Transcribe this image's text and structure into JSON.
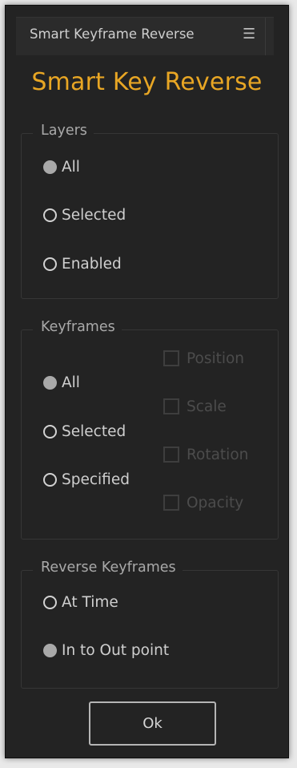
{
  "panel": {
    "tab_title": "Smart Keyframe Reverse",
    "menu_icon": "hamburger-menu-icon"
  },
  "title": "Smart Key Reverse",
  "layers": {
    "legend": "Layers",
    "options": [
      {
        "label": "All",
        "selected": true
      },
      {
        "label": "Selected",
        "selected": false
      },
      {
        "label": "Enabled",
        "selected": false
      }
    ]
  },
  "keyframes": {
    "legend": "Keyframes",
    "options": [
      {
        "label": "All",
        "selected": true
      },
      {
        "label": "Selected",
        "selected": false
      },
      {
        "label": "Specified",
        "selected": false
      }
    ],
    "properties": [
      {
        "label": "Position",
        "checked": false,
        "enabled": false
      },
      {
        "label": "Scale",
        "checked": false,
        "enabled": false
      },
      {
        "label": "Rotation",
        "checked": false,
        "enabled": false
      },
      {
        "label": "Opacity",
        "checked": false,
        "enabled": false
      }
    ]
  },
  "reverse": {
    "legend": "Reverse Keyframes",
    "options": [
      {
        "label": "At Time",
        "selected": false
      },
      {
        "label": "In to Out point",
        "selected": true
      }
    ]
  },
  "ok_label": "Ok",
  "colors": {
    "accent": "#e8a624",
    "panel_bg": "#232323",
    "text": "#cfcfcf",
    "disabled_text": "#4c4c4c"
  }
}
